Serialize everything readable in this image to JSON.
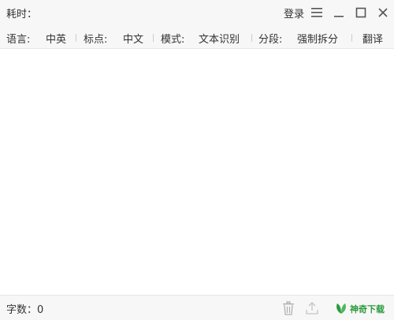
{
  "header": {
    "elapsed_label": "耗时：",
    "elapsed_value": "",
    "login_label": "登录"
  },
  "window_controls": [
    "menu-icon",
    "minimize-icon",
    "maximize-icon",
    "close-icon"
  ],
  "toolbar": {
    "language_label": "语言:",
    "language_value": "中英",
    "punctuation_label": "标点:",
    "punctuation_value": "中文",
    "mode_label": "模式:",
    "mode_value": "文本识别",
    "segment_label": "分段:",
    "segment_value": "强制拆分",
    "translate_label": "翻译"
  },
  "content": {
    "text": ""
  },
  "status": {
    "wordcount_label": "字数：",
    "wordcount_value": "0",
    "icons": [
      "trash-icon",
      "upload-icon"
    ],
    "logo_text": "神奇下载"
  },
  "colors": {
    "accent": "#2c9b3c",
    "bar_bg": "#f7f7f7"
  }
}
